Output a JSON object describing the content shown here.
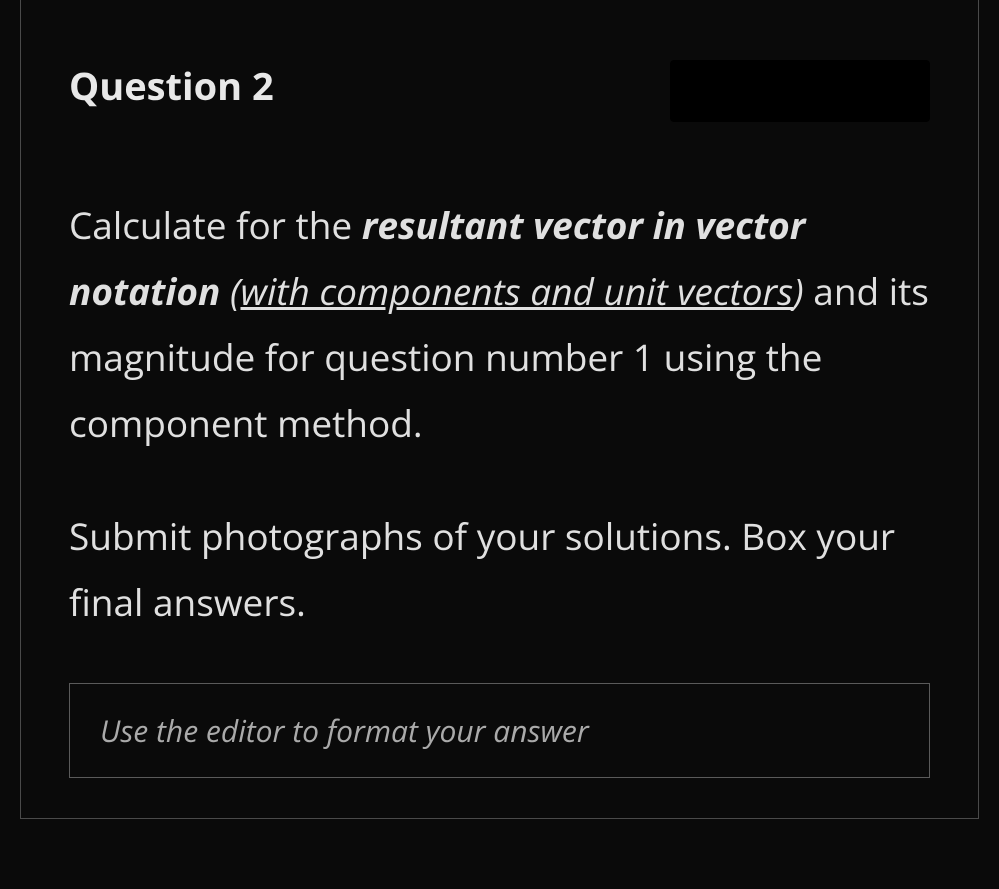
{
  "question": {
    "title": "Question 2",
    "body": {
      "intro": "Calculate for the ",
      "emphasis1": "resultant vector in vector notation",
      "space1": " ",
      "paren_open": "(",
      "underline_text": "with components and unit vectors",
      "paren_close": ")",
      "rest1": " and its magnitude for question number 1 using the component method.",
      "paragraph2": "Submit photographs of your solutions. Box your final answers."
    }
  },
  "editor": {
    "placeholder": "Use the editor to format your answer"
  }
}
